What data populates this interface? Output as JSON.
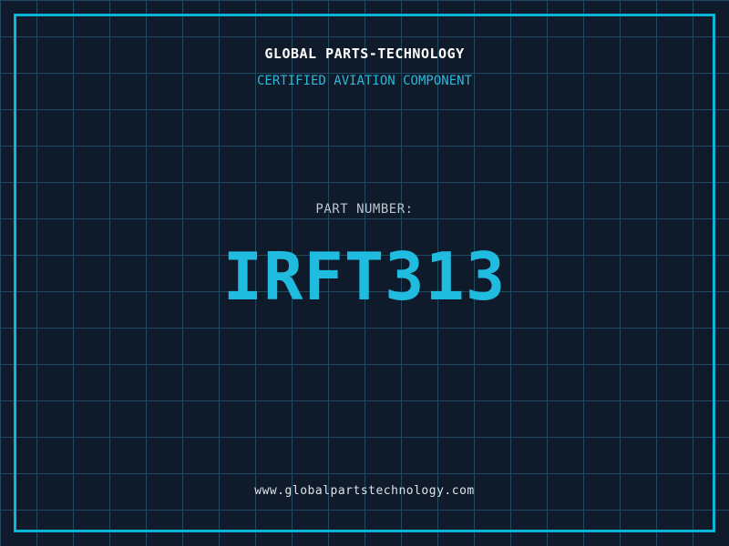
{
  "page": {
    "background_color": "#0f1a2a",
    "grid_color": "#1d4a5f",
    "frame_color": "#0cb4d8"
  },
  "header": {
    "company_name": "GLOBAL PARTS-TECHNOLOGY",
    "company_color": "#ffffff",
    "tagline": "CERTIFIED AVIATION COMPONENT",
    "tagline_color": "#2eb6d8"
  },
  "part": {
    "label": "PART NUMBER:",
    "label_color": "#bcc6d0",
    "number": "IRFT313",
    "number_color": "#1fbcdf"
  },
  "footer": {
    "website": "www.globalpartstechnology.com",
    "website_color": "#dde3e9"
  }
}
